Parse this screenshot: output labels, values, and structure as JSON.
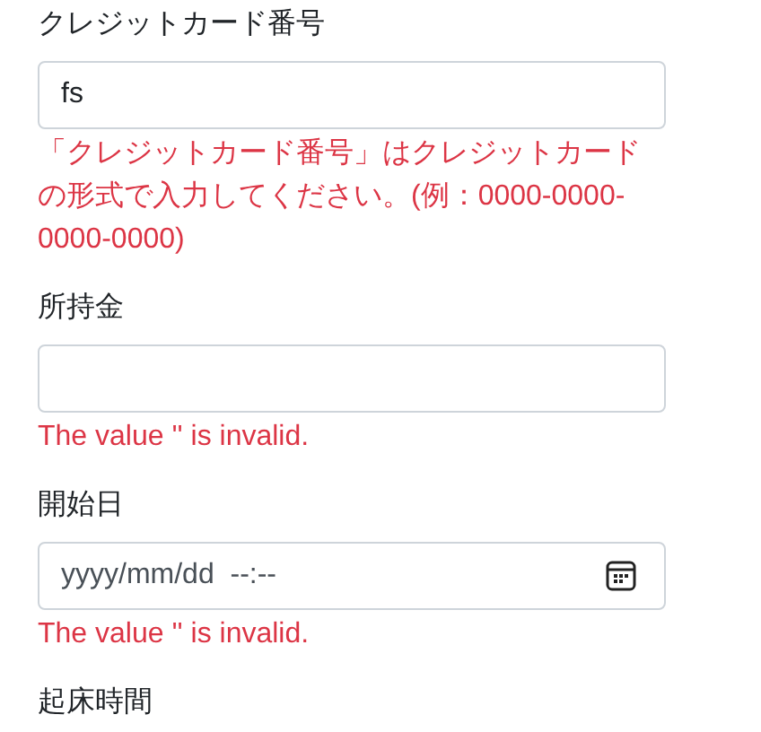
{
  "fields": [
    {
      "label": "クレジットカード番号",
      "kind": "text",
      "value": "fs",
      "error": "「クレジットカード番号」はクレジットカードの形式で入力してください。(例：0000-0000-0000-0000)"
    },
    {
      "label": "所持金",
      "kind": "text",
      "error": "The value '' is invalid."
    },
    {
      "label": "開始日",
      "kind": "datetime",
      "placeholder": "yyyy/mm/dd  --:--",
      "error": "The value '' is invalid."
    },
    {
      "label": "起床時間",
      "kind": "label-only"
    }
  ]
}
